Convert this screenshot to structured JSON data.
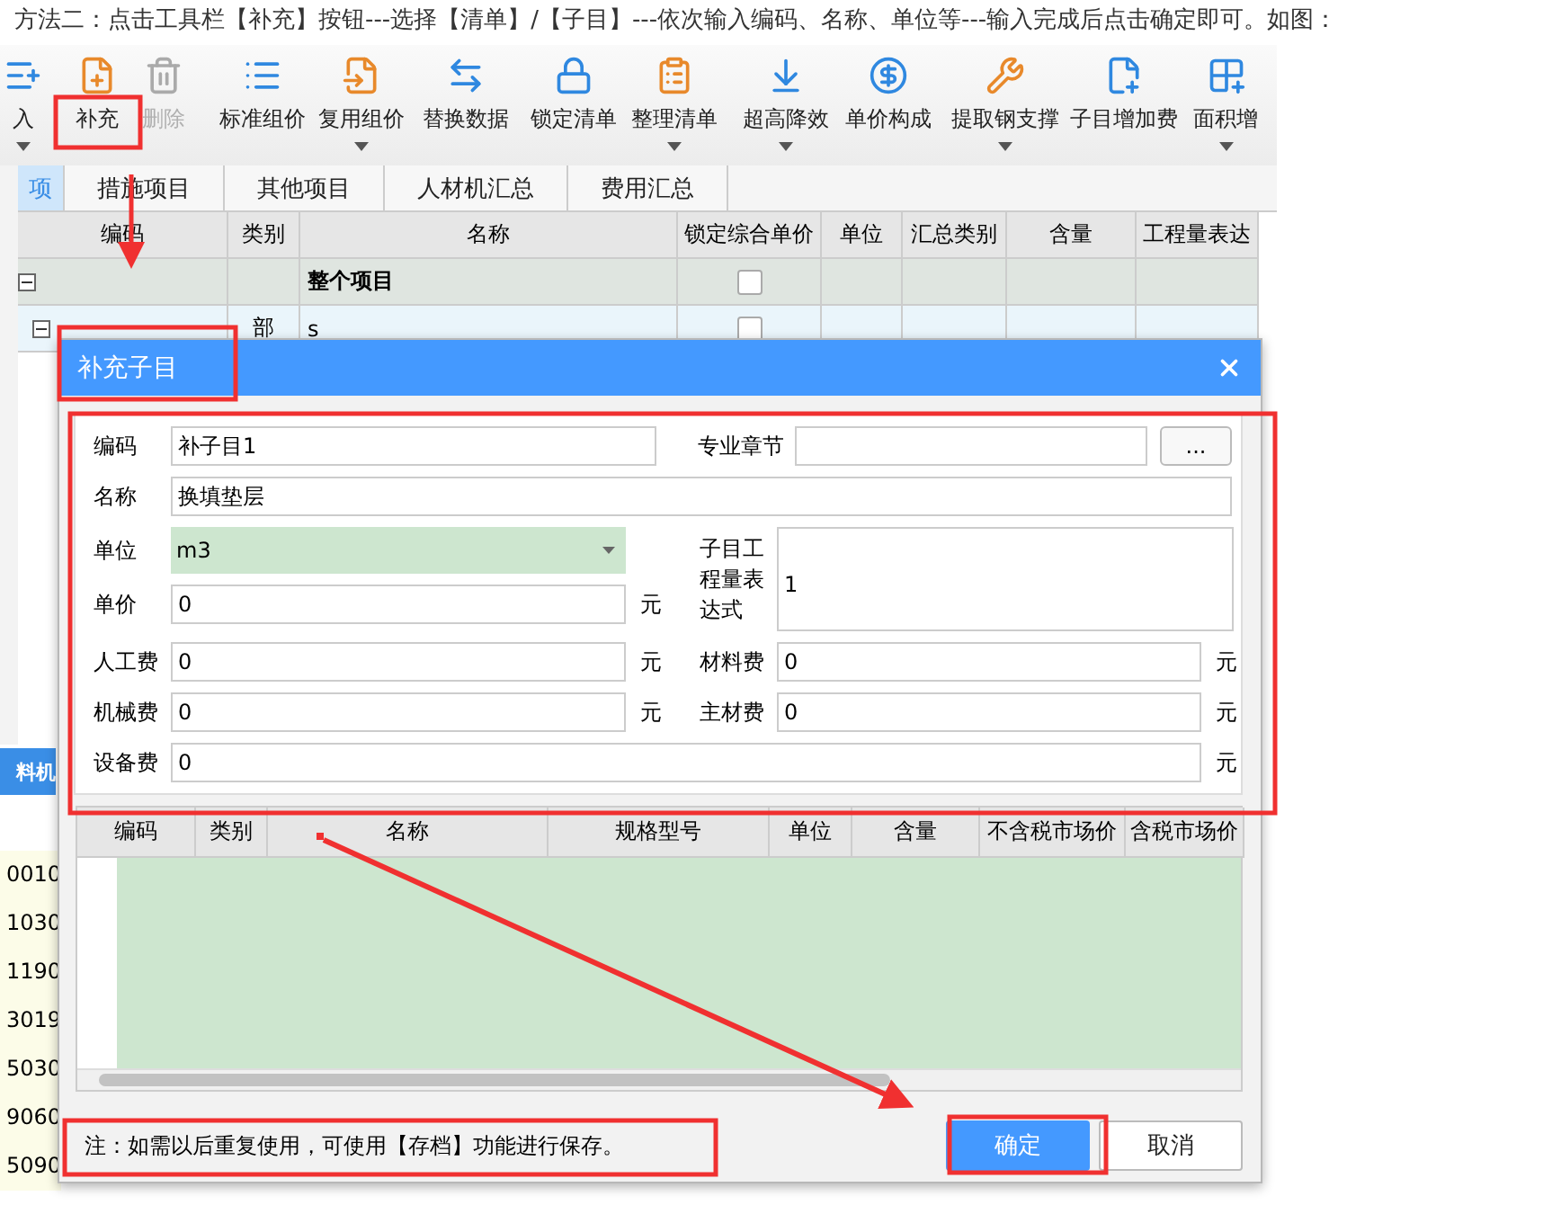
{
  "instruction": "方法二：点击工具栏【补充】按钮---选择【清单】/【子目】---依次输入编码、名称、单位等---输入完成后点击确定即可。如图：",
  "toolbar": [
    {
      "label": "入",
      "disabled": false,
      "has_menu": true
    },
    {
      "label": "补充",
      "disabled": false,
      "has_menu": false
    },
    {
      "label": "删除",
      "disabled": true,
      "has_menu": false
    },
    {
      "label": "标准组价",
      "disabled": false,
      "has_menu": false
    },
    {
      "label": "复用组价",
      "disabled": false,
      "has_menu": true
    },
    {
      "label": "替换数据",
      "disabled": false,
      "has_menu": false
    },
    {
      "label": "锁定清单",
      "disabled": false,
      "has_menu": false
    },
    {
      "label": "整理清单",
      "disabled": false,
      "has_menu": true
    },
    {
      "label": "超高降效",
      "disabled": false,
      "has_menu": true
    },
    {
      "label": "单价构成",
      "disabled": false,
      "has_menu": false
    },
    {
      "label": "提取钢支撑",
      "disabled": false,
      "has_menu": true
    },
    {
      "label": "子目增加费",
      "disabled": false,
      "has_menu": false
    },
    {
      "label": "面积增",
      "disabled": false,
      "has_menu": true
    }
  ],
  "tabs": [
    {
      "label": "项",
      "selected": true
    },
    {
      "label": "措施项目",
      "selected": false
    },
    {
      "label": "其他项目",
      "selected": false
    },
    {
      "label": "人材机汇总",
      "selected": false
    },
    {
      "label": "费用汇总",
      "selected": false
    }
  ],
  "table": {
    "columns": [
      "编码",
      "类别",
      "名称",
      "锁定综合单价",
      "单位",
      "汇总类别",
      "含量",
      "工程量表达"
    ],
    "rows": [
      {
        "type": "",
        "name": "整个项目",
        "locked": false,
        "group": true
      },
      {
        "type": "部",
        "name": "s",
        "locked": false,
        "group": false
      }
    ]
  },
  "lower_panel": {
    "tab": {
      "label": "料机",
      "selected": true
    },
    "codes": [
      "0010",
      "1030",
      "1190",
      "3019",
      "5030",
      "9060",
      "5090"
    ]
  },
  "dialog": {
    "title": "补充子目",
    "code": {
      "label": "编码",
      "value": "补子目1"
    },
    "chapter": {
      "label": "专业章节",
      "button": "..."
    },
    "name": {
      "label": "名称",
      "value": "换填垫层"
    },
    "unit": {
      "label": "单位",
      "value": "m3"
    },
    "price": {
      "label": "单价",
      "value": "0",
      "unit": "元"
    },
    "expression": {
      "label": "子目工程量表达式",
      "value": "1"
    },
    "costs": [
      {
        "label": "人工费",
        "value": "0",
        "unit": "元"
      },
      {
        "label": "材料费",
        "value": "0",
        "unit": "元"
      },
      {
        "label": "机械费",
        "value": "0",
        "unit": "元"
      },
      {
        "label": "主材费",
        "value": "0",
        "unit": "元"
      }
    ],
    "equipment": {
      "label": "设备费",
      "value": "0",
      "unit": "元"
    },
    "grid_columns": [
      "编码",
      "类别",
      "名称",
      "规格型号",
      "单位",
      "含量",
      "不含税市场价",
      "含税市场价"
    ],
    "note": "注：如需以后重复使用，可使用【存档】功能进行保存。",
    "buttons": [
      {
        "label": "确定",
        "primary": true
      },
      {
        "label": "取消",
        "primary": false
      }
    ]
  }
}
